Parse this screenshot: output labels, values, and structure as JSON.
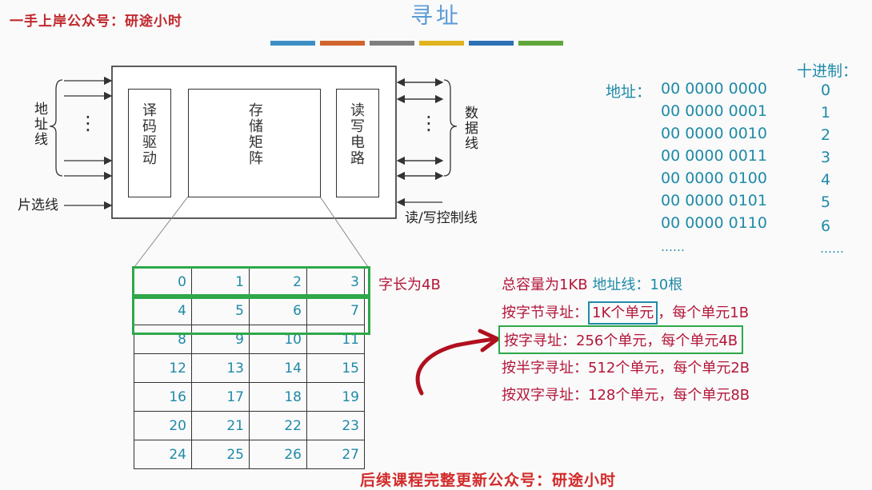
{
  "watermark": "一手上岸公众号：研途小时",
  "title": "寻址",
  "color_bars": [
    "#3d8fc6",
    "#d0642b",
    "#7f7f7f",
    "#e1b320",
    "#2d6fb5",
    "#5ea63a"
  ],
  "diagram": {
    "address_lines_label": "地址线",
    "chip_select_label": "片选线",
    "data_lines_label": "数据线",
    "rw_control_label": "读/写控制线",
    "decoder_label": "译码驱动",
    "storage_matrix_label": "存储矩阵",
    "rw_circuit_label": "读写电路",
    "dots": "⋮"
  },
  "address_table": {
    "addr_label": "地址：",
    "decimal_header": "十进制：",
    "rows": [
      {
        "bin": "00 0000 0000",
        "dec": "0"
      },
      {
        "bin": "00 0000 0001",
        "dec": "1"
      },
      {
        "bin": "00 0000 0010",
        "dec": "2"
      },
      {
        "bin": "00 0000 0011",
        "dec": "3"
      },
      {
        "bin": "00 0000 0100",
        "dec": "4"
      },
      {
        "bin": "00 0000 0101",
        "dec": "5"
      },
      {
        "bin": "00 0000 0110",
        "dec": "6"
      }
    ],
    "ellipsis_bin": "……",
    "ellipsis_dec": "……"
  },
  "memory_grid": {
    "rows": [
      [
        "0",
        "1",
        "2",
        "3"
      ],
      [
        "4",
        "5",
        "6",
        "7"
      ],
      [
        "8",
        "9",
        "10",
        "11"
      ],
      [
        "12",
        "13",
        "14",
        "15"
      ],
      [
        "16",
        "17",
        "18",
        "19"
      ],
      [
        "20",
        "21",
        "22",
        "23"
      ],
      [
        "24",
        "25",
        "26",
        "27"
      ]
    ],
    "word_length_label": "字长为4B"
  },
  "notes": {
    "capacity": "总容量为1KB",
    "address_lines": "地址线：10根",
    "byte_addr_prefix": "按字节寻址：",
    "byte_addr_highlight": "1K个单元",
    "byte_addr_suffix": "，每个单元1B",
    "word_addr": "按字寻址：256个单元，每个单元4B",
    "halfword_addr": "按半字寻址：512个单元，每个单元2B",
    "doubleword_addr": "按双字寻址：128个单元，每个单元8B"
  },
  "footer": "后续课程完整更新公众号：研途小时"
}
